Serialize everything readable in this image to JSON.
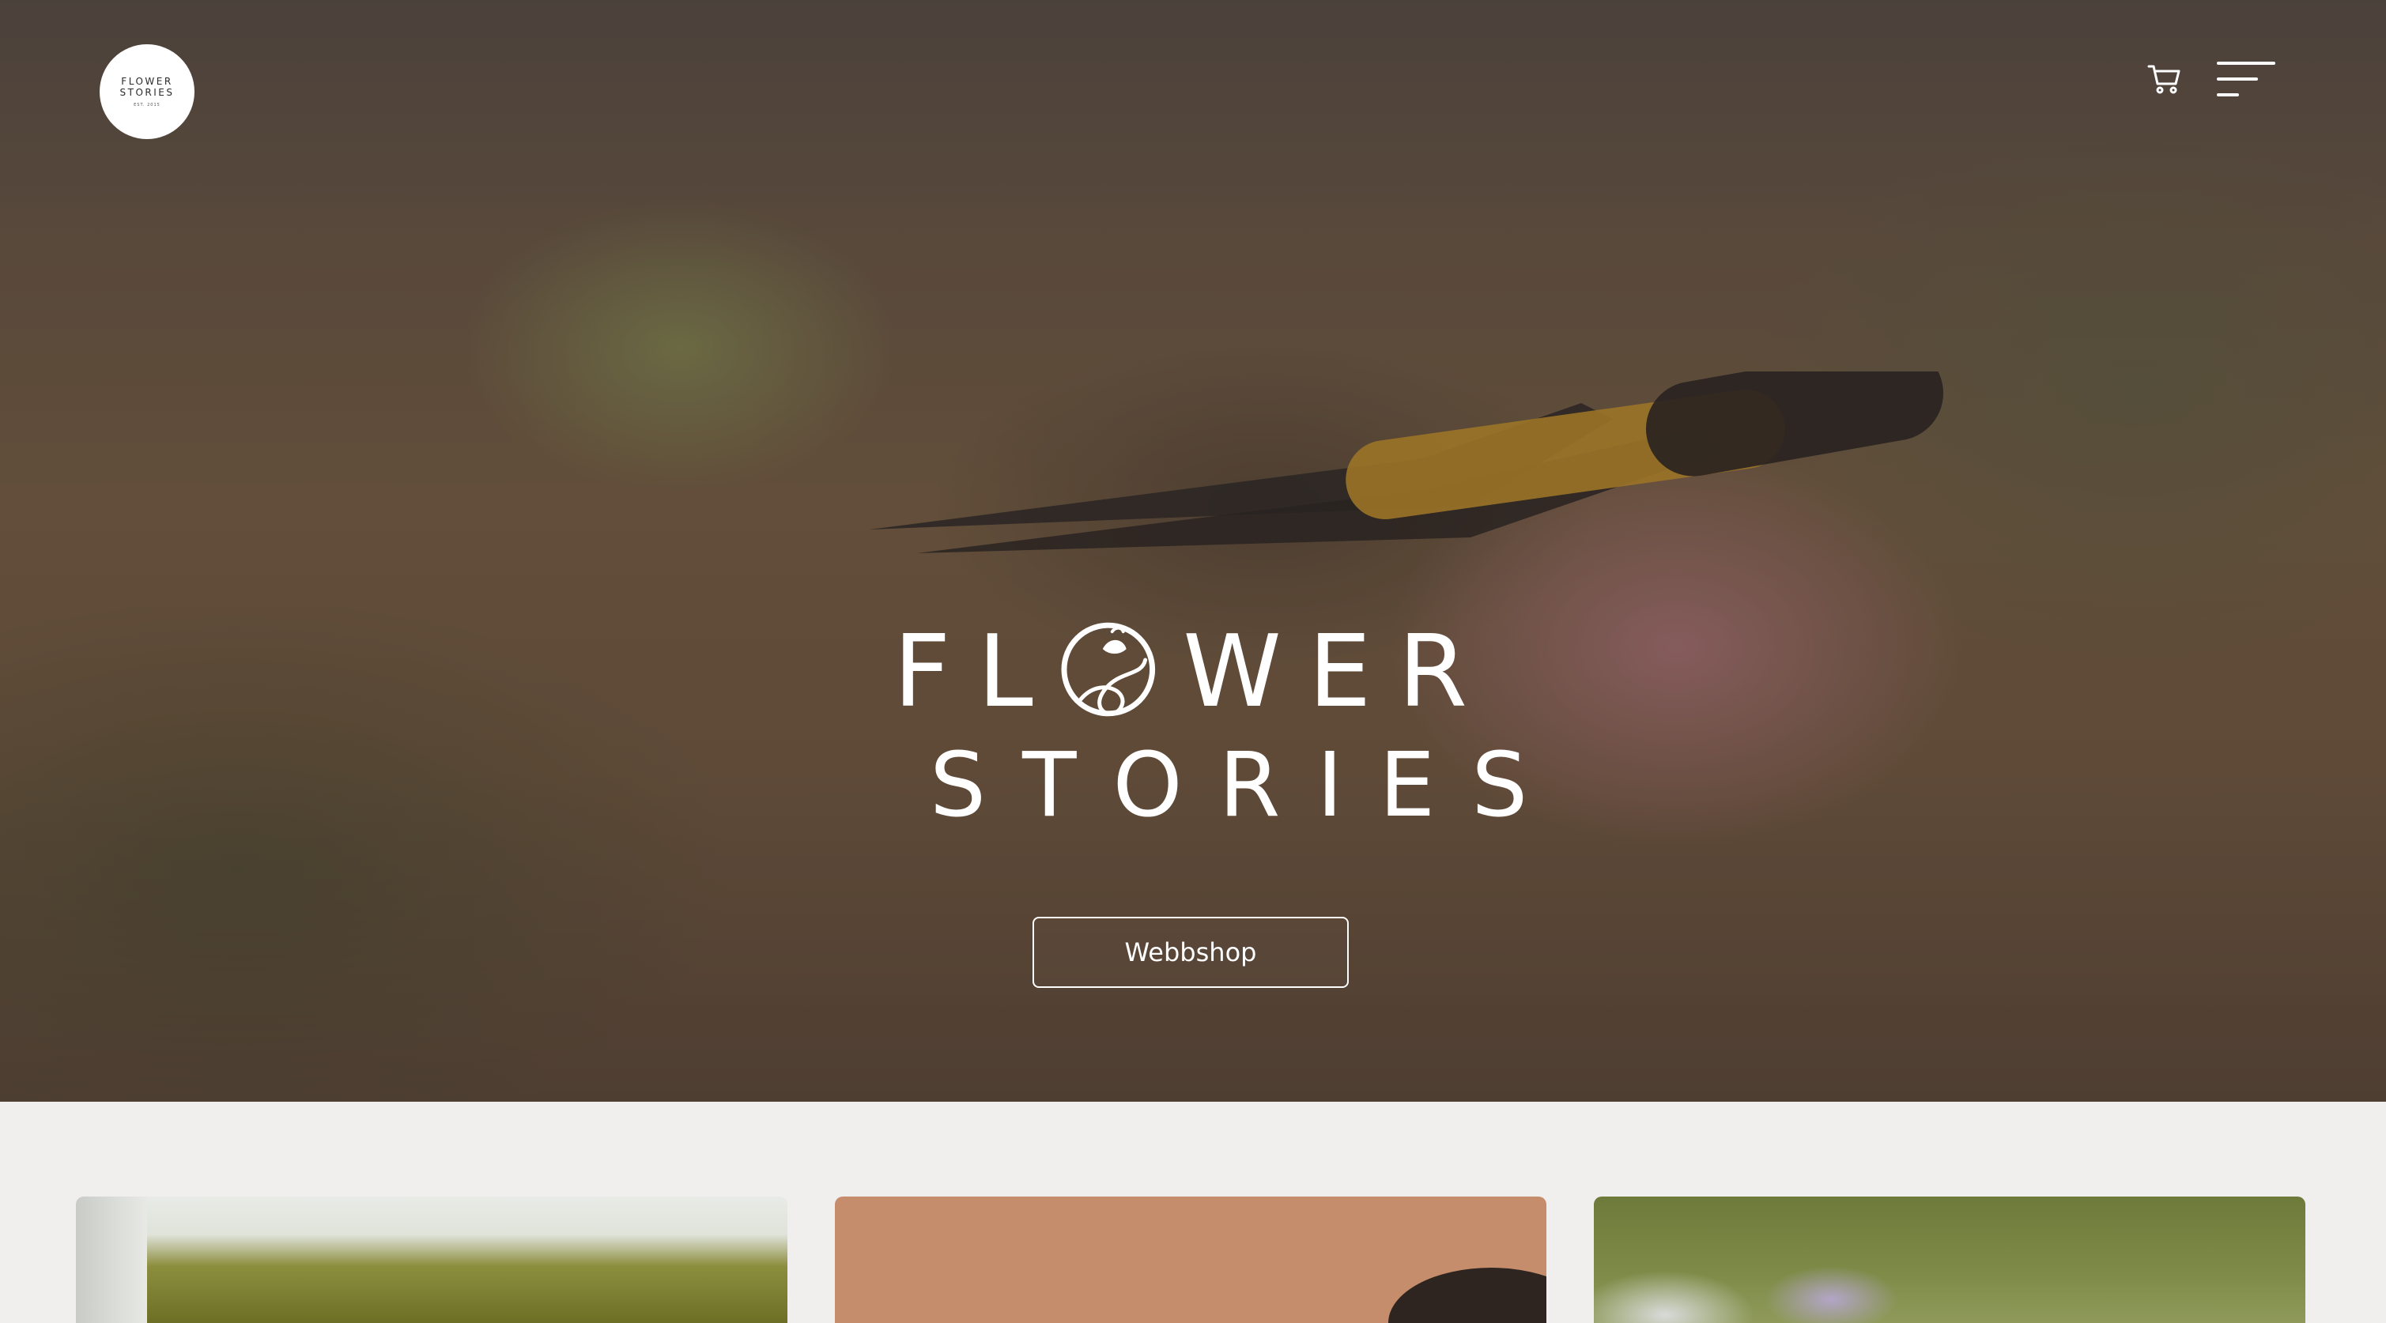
{
  "header": {
    "logo_line1": "FLOWER",
    "logo_line2": "STORIES",
    "logo_line3": "EST. 2015",
    "cart_icon": "cart-icon",
    "menu_icon": "hamburger-menu-icon"
  },
  "hero": {
    "title_part1": "FL",
    "title_part2": "WER",
    "title_line2": "STORIES",
    "cta_label": "Webbshop"
  },
  "colors": {
    "page_background": "#f0efee",
    "hero_text": "#ffffff",
    "accent_pink": "#d6889e"
  }
}
